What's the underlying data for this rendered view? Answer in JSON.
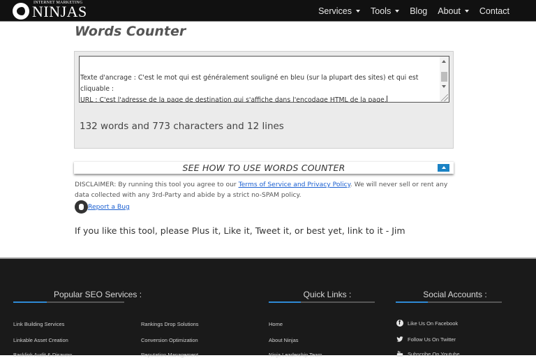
{
  "brand": {
    "small_text": "INTERNET MARKETING",
    "name": "NINJAS"
  },
  "nav": {
    "items": [
      {
        "label": "Services",
        "has_dropdown": true
      },
      {
        "label": "Tools",
        "has_dropdown": true
      },
      {
        "label": "Blog",
        "has_dropdown": false
      },
      {
        "label": "About",
        "has_dropdown": true
      },
      {
        "label": "Contact",
        "has_dropdown": false
      }
    ]
  },
  "page": {
    "title": "Words Counter"
  },
  "tool": {
    "textarea_lines": [
      "",
      "",
      "Texte d'ancrage : C'est le mot qui est généralement souligné en bleu (sur la plupart des sites) et qui est",
      "cliquable :",
      "URL : C'est l'adresse de la page de destination qui s'affiche dans l'encodage HTML de la page."
    ],
    "stats": "132 words and 773 characters and 12 lines"
  },
  "howto": {
    "label": "SEE HOW TO USE WORDS COUNTER"
  },
  "disclaimer": {
    "prefix": "DISCLAIMER: By running this tool you agree to our ",
    "link": "Terms of Service and Privacy Policy",
    "suffix": ". We will never sell or rent any data collected with any 3rd-Party and abide by a strict no-SPAM policy."
  },
  "report_bug": {
    "label": "Report a Bug"
  },
  "plea": "If you like this tool, please Plus it, Like it, Tweet it, or best yet, link to it - Jim",
  "footer": {
    "colors": {
      "accent": "#2f8ad6",
      "background": "#1a1a1a"
    },
    "popular": {
      "heading": "Popular SEO Services :",
      "col1": [
        "Link Building Services",
        "Linkable Asset Creation",
        "Backlink Audit & Disavow"
      ],
      "col2": [
        "Rankings Drop Solutions",
        "Conversion Optimization",
        "Reputation Management"
      ]
    },
    "quick": {
      "heading": "Quick Links :",
      "links": [
        "Home",
        "About Ninjas",
        "Ninja Leadership Team"
      ]
    },
    "social": {
      "heading": "Social Accounts :",
      "links": [
        {
          "icon": "facebook-icon",
          "label": "Like Us On Facebook"
        },
        {
          "icon": "twitter-icon",
          "label": "Follow Us On Twitter"
        },
        {
          "icon": "youtube-icon",
          "label": "Subscribe On Youtube"
        }
      ]
    }
  }
}
